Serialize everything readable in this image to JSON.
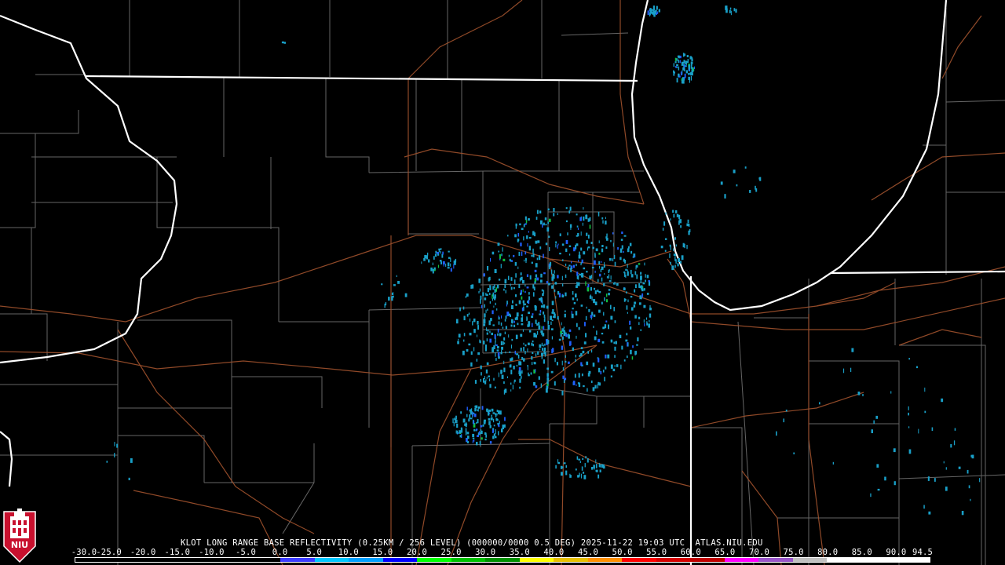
{
  "product": {
    "caption": "KLOT LONG RANGE BASE REFLECTIVITY (0.25KM / 256 LEVEL) (000000/0000 0.5 DEG) 2025-11-22 19:03 UTC  ATLAS.NIU.EDU"
  },
  "logo": {
    "text": "NIU",
    "icon": "niu-huskie-tower-logo"
  },
  "colorbar": {
    "ticks": [
      "-30.0",
      "-25.0",
      "-20.0",
      "-15.0",
      "-10.0",
      "-5.0",
      "0.0",
      "5.0",
      "10.0",
      "15.0",
      "20.0",
      "25.0",
      "30.0",
      "35.0",
      "40.0",
      "45.0",
      "50.0",
      "55.0",
      "60.0",
      "65.0",
      "70.0",
      "75.0",
      "80.0",
      "85.0",
      "90.0",
      "94.5"
    ],
    "colors": [
      "#000000",
      "#000000",
      "#000000",
      "#000000",
      "#000000",
      "#000000",
      "#3c3cff",
      "#00c8ff",
      "#00a0ff",
      "#0000ff",
      "#00ff00",
      "#00c000",
      "#009000",
      "#ffff00",
      "#e7c000",
      "#ff9000",
      "#ff0000",
      "#d60000",
      "#c00000",
      "#ff00ff",
      "#9955c9",
      "#c0c0c0",
      "#ffffff",
      "#ffffff",
      "#ffffff"
    ]
  },
  "map_colors": {
    "background": "#000000",
    "county_lines": "#808080",
    "state_lines": "#ffffff",
    "highways": "#a0522d",
    "light_echo": "#19a0c8",
    "moderate_echo": "#2060ff",
    "strong_echo": "#10c040"
  }
}
